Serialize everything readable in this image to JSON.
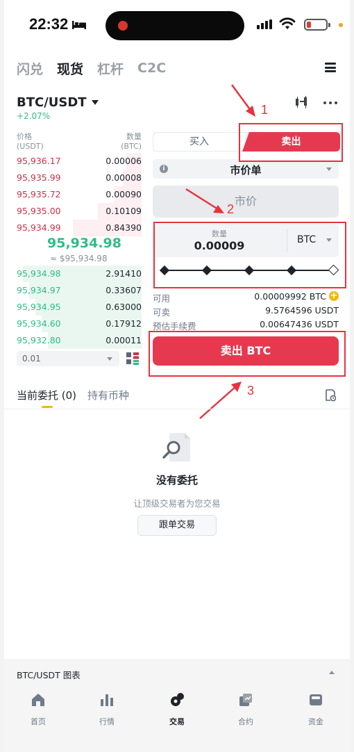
{
  "status_bar": {
    "time": "22:32"
  },
  "top_tabs": [
    {
      "label": "闪兑",
      "active": false
    },
    {
      "label": "现货",
      "active": true
    },
    {
      "label": "杠杆",
      "active": false
    },
    {
      "label": "C2C",
      "active": false
    }
  ],
  "pair": {
    "symbol": "BTC/USDT",
    "change": "+2.07%"
  },
  "order_book": {
    "price_header": "价格",
    "price_unit": "(USDT)",
    "qty_header": "数量",
    "qty_unit": "(BTC)",
    "asks": [
      {
        "price": "95,936.17",
        "qty": "0.00006",
        "depth": 0.12
      },
      {
        "price": "95,935.99",
        "qty": "0.00008",
        "depth": 0.15
      },
      {
        "price": "95,935.72",
        "qty": "0.00090",
        "depth": 0.22
      },
      {
        "price": "95,935.00",
        "qty": "0.10109",
        "depth": 0.35
      },
      {
        "price": "95,934.99",
        "qty": "0.84390",
        "depth": 0.55
      }
    ],
    "mid_price": "95,934.98",
    "mid_price_usd": "≈ $95,934.98",
    "bids": [
      {
        "price": "95,934.98",
        "qty": "2.91410",
        "depth": 0.95
      },
      {
        "price": "95,934.97",
        "qty": "0.33607",
        "depth": 0.9
      },
      {
        "price": "95,934.95",
        "qty": "0.63000",
        "depth": 0.85
      },
      {
        "price": "95,934.60",
        "qty": "0.17912",
        "depth": 0.8
      },
      {
        "price": "95,932.80",
        "qty": "0.00011",
        "depth": 0.75
      }
    ],
    "precision": "0.01"
  },
  "trade_form": {
    "buy_label": "买入",
    "sell_label": "卖出",
    "order_type": "市价单",
    "market_label": "市价",
    "qty_label": "数量",
    "qty_value": "0.00009",
    "qty_unit": "BTC",
    "available_label": "可用",
    "available_value": "0.00009992 BTC",
    "sellable_label": "可卖",
    "sellable_value": "9.5764596 USDT",
    "fee_label": "预估手续费",
    "fee_value": "0.00647436 USDT",
    "submit_label": "卖出 BTC"
  },
  "annotations": [
    "1",
    "2",
    "3"
  ],
  "orders": {
    "tab_open": "当前委托 (0)",
    "tab_holdings": "持有币种",
    "empty_title": "没有委托",
    "empty_subtitle": "让顶级交易者为您交易",
    "copy_button": "跟单交易"
  },
  "chart_bar": {
    "label": "BTC/USDT 图表"
  },
  "bottom_nav": [
    {
      "label": "首页",
      "icon": "home-icon",
      "active": false
    },
    {
      "label": "行情",
      "icon": "markets-icon",
      "active": false
    },
    {
      "label": "交易",
      "icon": "trade-icon",
      "active": true
    },
    {
      "label": "合约",
      "icon": "futures-icon",
      "active": false
    },
    {
      "label": "资金",
      "icon": "wallet-icon",
      "active": false
    }
  ],
  "colors": {
    "sell_red": "#e63950",
    "buy_green": "#2ebd85",
    "ask_red": "#cf304a",
    "annotation_red": "#e8323c",
    "accent_yellow": "#f0b90b"
  }
}
